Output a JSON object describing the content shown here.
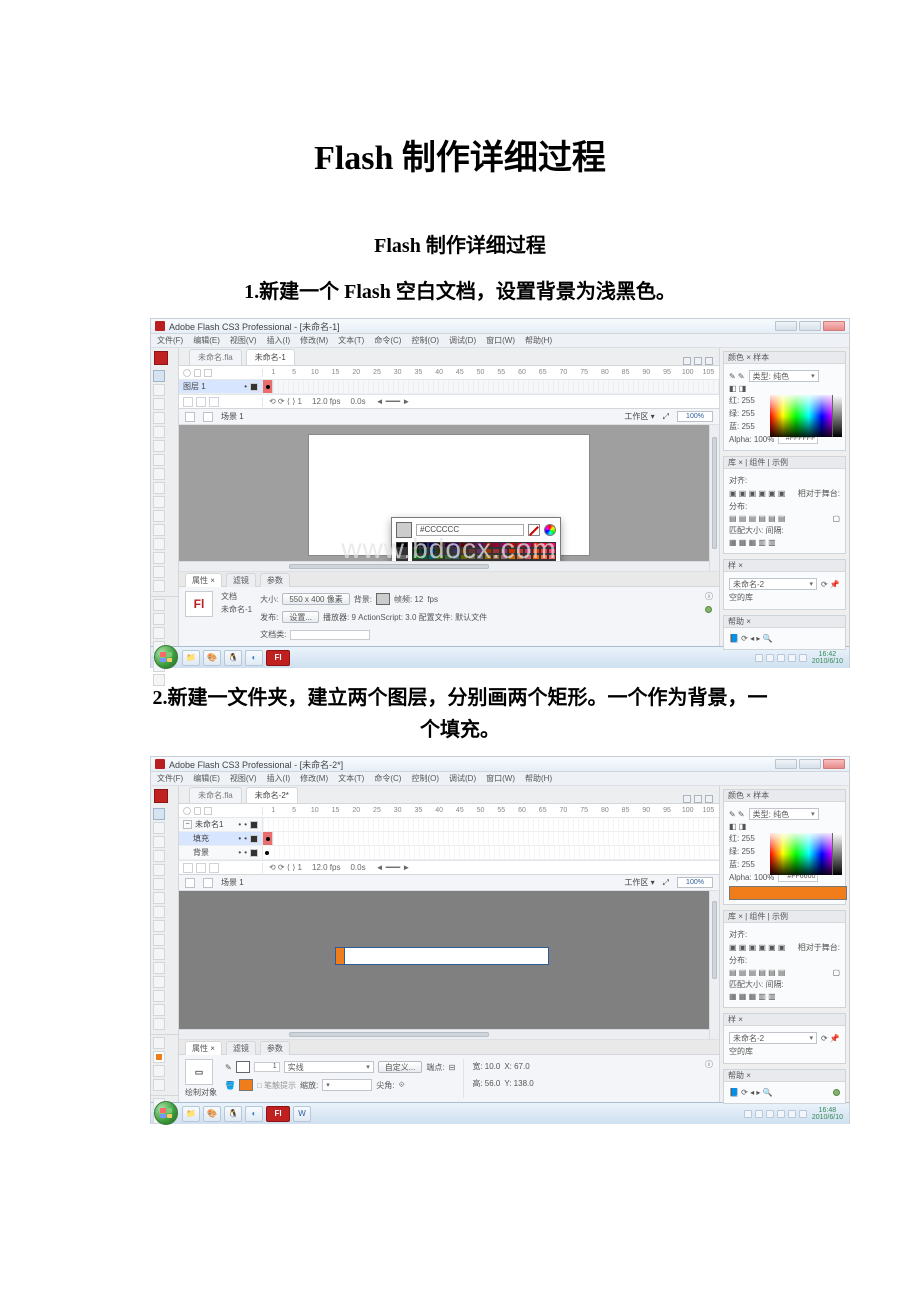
{
  "doc": {
    "title": "Flash 制作详细过程",
    "subtitle": "Flash 制作详细过程",
    "step1": "1.新建一个 Flash 空白文档，设置背景为浅黑色。",
    "step2": "2.新建一文件夹，建立两个图层，分别画两个矩形。一个作为背景，一个填充。"
  },
  "app": {
    "title": "Adobe Flash CS3 Professional - [未命名-1]",
    "title2": "Adobe Flash CS3 Professional - [未命名-2*]",
    "menu": [
      "文件(F)",
      "编辑(E)",
      "视图(V)",
      "插入(I)",
      "修改(M)",
      "文本(T)",
      "命令(C)",
      "控制(O)",
      "调试(D)",
      "窗口(W)",
      "帮助(H)"
    ],
    "tabs1_a": "未命名.fla",
    "tabs1_b": "未命名-1",
    "tabs2_a": "未命名.fla",
    "tabs2_b": "未命名-2*",
    "layer1": "图层 1",
    "folder": "未命名1",
    "layerFill": "填充",
    "layerBg": "背景",
    "rulerNums": [
      "1",
      "5",
      "10",
      "15",
      "20",
      "25",
      "30",
      "35",
      "40",
      "45",
      "50",
      "55",
      "60",
      "65",
      "70",
      "75",
      "80",
      "85",
      "90",
      "95",
      "100",
      "105"
    ],
    "tlfoot_fps": "12.0 fps",
    "tlfoot_time": "0.0s",
    "scene": "场景 1",
    "workarea": "工作区 ▾",
    "zoom": "100%",
    "watermark": "www.bdocx.com"
  },
  "picker": {
    "hex": "#CCCCCC"
  },
  "colorPanel": {
    "tab": "颜色 × 样本",
    "type": "类型: 纯色",
    "r": "红: 255",
    "g": "绿: 255",
    "b": "蓝: 255",
    "alpha": "Alpha: 100%",
    "hex1": "#FFFFFF",
    "hex2": "#FF6600"
  },
  "libPanel": {
    "tab": "库 × | 组件 | 示例",
    "line1": "对齐:",
    "line2": "分布:",
    "line3": "匹配大小:  间隔:",
    "relstage": "相对于舞台:"
  },
  "swatchPanel": {
    "tab": "样 ×",
    "name": "未命名-2",
    "empty": "空的库"
  },
  "props1": {
    "tabA": "属性 ×",
    "tabB": "滤镜",
    "tabC": "参数",
    "docLabel": "文档",
    "docName": "未命名-1",
    "sizeLbl": "大小:",
    "sizeVal": "550 x 400 像素",
    "bgLbl": "背景:",
    "pubLbl": "发布:",
    "setBtn": "设置...",
    "fpsLbl": "帧频: 12",
    "fpsUnit": "fps",
    "player": "播放器: 9   ActionScript: 3.0   配置文件: 默认文件",
    "docclass": "文档类:"
  },
  "props2": {
    "tabA": "属性 ×",
    "tabB": "滤镜",
    "tabC": "参数",
    "shapeLbl": "绘制对象",
    "strokeEmpty": "—",
    "strokeStyle": "实线",
    "customBtn": "自定义...",
    "capLbl": "端点:",
    "joinLbl": "尖角:",
    "w": "宽: 10.0",
    "x": "X: 67.0",
    "h": "高: 56.0",
    "y": "Y: 138.0"
  },
  "help": {
    "tab": "帮助 ×"
  },
  "tray": {
    "time1": "16:42",
    "date1": "2010/6/10",
    "time2": "16:48",
    "date2": "2010/6/10"
  }
}
